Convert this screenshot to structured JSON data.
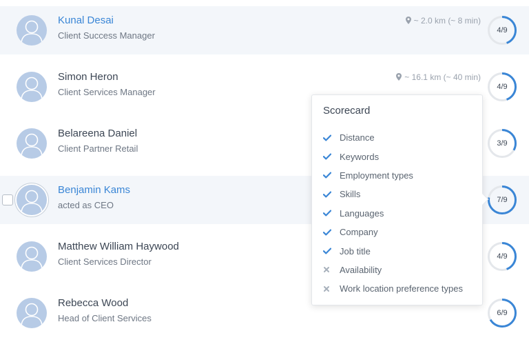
{
  "candidates": [
    {
      "name": "Kunal Desai",
      "title": "Client Success Manager",
      "distance": "~ 2.0 km (~ 8 min)",
      "score_label": "4/9",
      "score": 4,
      "score_max": 9,
      "highlighted": true,
      "name_link": true
    },
    {
      "name": "Simon Heron",
      "title": "Client Services Manager",
      "distance": "~ 16.1 km (~ 40 min)",
      "score_label": "4/9",
      "score": 4,
      "score_max": 9,
      "highlighted": false,
      "name_link": false
    },
    {
      "name": "Belareena Daniel",
      "title": "Client Partner Retail",
      "distance": "",
      "score_label": "3/9",
      "score": 3,
      "score_max": 9,
      "highlighted": false,
      "name_link": false
    },
    {
      "name": "Benjamin Kams",
      "title": "acted as CEO",
      "distance": "",
      "score_label": "7/9",
      "score": 7,
      "score_max": 9,
      "highlighted": true,
      "name_link": true,
      "checkbox": true
    },
    {
      "name": "Matthew William Haywood",
      "title": "Client Services Director",
      "distance": "",
      "score_label": "4/9",
      "score": 4,
      "score_max": 9,
      "highlighted": false,
      "name_link": false
    },
    {
      "name": "Rebecca Wood",
      "title": "Head of Client Services",
      "distance": "",
      "score_label": "6/9",
      "score": 6,
      "score_max": 9,
      "highlighted": false,
      "name_link": false
    }
  ],
  "scorecard": {
    "title": "Scorecard",
    "items": [
      {
        "label": "Distance",
        "matched": true
      },
      {
        "label": "Keywords",
        "matched": true
      },
      {
        "label": "Employment types",
        "matched": true
      },
      {
        "label": "Skills",
        "matched": true
      },
      {
        "label": "Languages",
        "matched": true
      },
      {
        "label": "Company",
        "matched": true
      },
      {
        "label": "Job title",
        "matched": true
      },
      {
        "label": "Availability",
        "matched": false
      },
      {
        "label": "Work location preference types",
        "matched": false
      }
    ]
  },
  "icons": {
    "avatar": "user-placeholder-icon",
    "distance": "map-pin-icon",
    "matched": "check-icon",
    "unmatched": "x-icon"
  },
  "colors": {
    "accent": "#3a86d6",
    "ring_track": "#e4e7eb",
    "avatar_bg": "#b7cbe6",
    "highlight_row": "#f3f6fa"
  }
}
